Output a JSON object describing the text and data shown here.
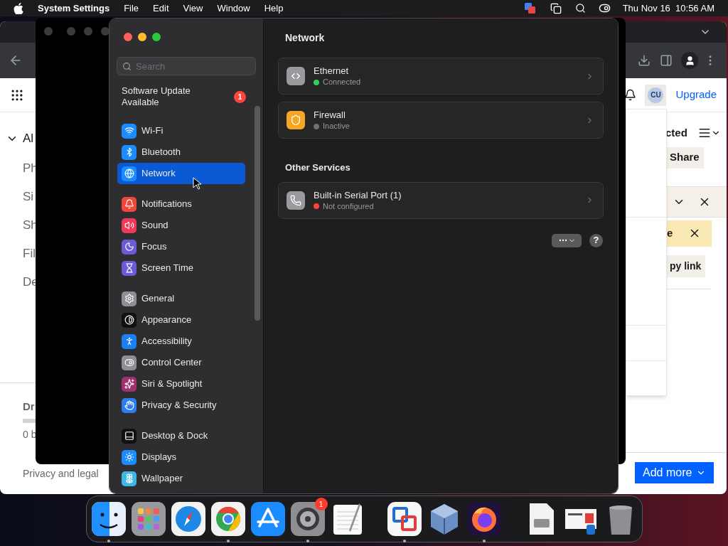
{
  "menu_bar": {
    "app_name": "System Settings",
    "menus": [
      "File",
      "Edit",
      "View",
      "Window",
      "Help"
    ],
    "clock": "Thu Nov 16  10:56 AM"
  },
  "browser": {
    "sidebar_heading": "Al",
    "sidebar_items": [
      "Ph",
      "Si",
      "Sh",
      "Fil",
      "De"
    ],
    "storage": {
      "title": "Dr",
      "level": 0,
      "reading": "0 b"
    },
    "footer_link": "Privacy and legal",
    "avatar": "CU",
    "upgrade": "Upgrade",
    "list_heading": "cted",
    "share": "Share",
    "banner_text": "e",
    "copy_link": "py link",
    "add_more": "Add more"
  },
  "settings": {
    "search_placeholder": "Search",
    "update": {
      "text": "Software Update Available",
      "badge": "1"
    },
    "sidebar_groups": [
      {
        "items": [
          {
            "label": "Wi-Fi",
            "kind": "wifi",
            "color": "#1a8cff",
            "selected": false
          },
          {
            "label": "Bluetooth",
            "kind": "bluetooth",
            "color": "#1a8cff",
            "selected": false
          },
          {
            "label": "Network",
            "kind": "network",
            "color": "#1a8cff",
            "selected": true
          }
        ]
      },
      {
        "items": [
          {
            "label": "Notifications",
            "kind": "notifications",
            "color": "#f2463c",
            "selected": false
          },
          {
            "label": "Sound",
            "kind": "sound",
            "color": "#f2375a",
            "selected": false
          },
          {
            "label": "Focus",
            "kind": "focus",
            "color": "#6b5bd6",
            "selected": false
          },
          {
            "label": "Screen Time",
            "kind": "screen_time",
            "color": "#6b5bd6",
            "selected": false
          }
        ]
      },
      {
        "items": [
          {
            "label": "General",
            "kind": "general",
            "color": "#8e8e93",
            "selected": false
          },
          {
            "label": "Appearance",
            "kind": "appearance",
            "color": "#101010",
            "selected": false
          },
          {
            "label": "Accessibility",
            "kind": "accessibility",
            "color": "#1a7ff0",
            "selected": false
          },
          {
            "label": "Control Center",
            "kind": "control_center",
            "color": "#8e8e93",
            "selected": false
          },
          {
            "label": "Siri & Spotlight",
            "kind": "siri",
            "color": "#a0306e",
            "selected": false
          },
          {
            "label": "Privacy & Security",
            "kind": "privacy",
            "color": "#2c7ef0",
            "selected": false
          }
        ]
      },
      {
        "items": [
          {
            "label": "Desktop & Dock",
            "kind": "desktop_dock",
            "color": "#101010",
            "selected": false
          },
          {
            "label": "Displays",
            "kind": "displays",
            "color": "#1a8cff",
            "selected": false
          },
          {
            "label": "Wallpaper",
            "kind": "wallpaper",
            "color": "#3db8e6",
            "selected": false
          }
        ]
      }
    ],
    "title": "Network",
    "services": [
      {
        "name": "Ethernet",
        "status": "Connected",
        "color": "#30d158",
        "kind": "ethernet"
      },
      {
        "name": "Firewall",
        "status": "Inactive",
        "color": "#6e6e73",
        "kind": "firewall"
      }
    ],
    "other_title": "Other Services",
    "other_services": [
      {
        "name": "Built-in Serial Port (1)",
        "status": "Not configured",
        "color": "#ff453a",
        "kind": "serial"
      }
    ],
    "help": "?"
  },
  "dock": [
    {
      "kind": "finder",
      "running": true
    },
    {
      "kind": "launchpad",
      "running": false
    },
    {
      "kind": "safari",
      "running": false
    },
    {
      "kind": "chrome",
      "running": true
    },
    {
      "kind": "appstore",
      "running": false
    },
    {
      "kind": "settings",
      "running": true,
      "badge": "1"
    },
    {
      "kind": "textedit",
      "running": false
    },
    {
      "kind": "separator"
    },
    {
      "kind": "parallels",
      "running": true
    },
    {
      "kind": "virtualbox",
      "running": false
    },
    {
      "kind": "firefox",
      "running": true
    },
    {
      "kind": "separator"
    },
    {
      "kind": "disk",
      "running": false
    },
    {
      "kind": "document",
      "running": false
    },
    {
      "kind": "trash",
      "running": false
    }
  ]
}
